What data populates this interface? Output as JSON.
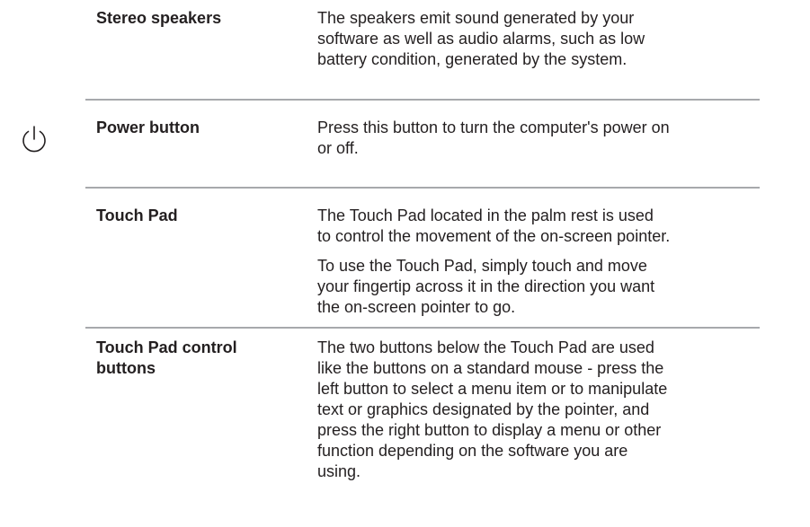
{
  "rows": [
    {
      "term": "Stereo speakers",
      "desc": [
        "The speakers emit sound generated by your",
        "software as well as audio alarms, such as low",
        "battery condition, generated by the system."
      ]
    },
    {
      "term": "Power button",
      "icon": "power-icon",
      "desc": [
        "Press this button to turn the computer's power on",
        "or off."
      ]
    },
    {
      "term": "Touch Pad",
      "desc": [
        "The Touch Pad located in the palm rest is used",
        "to control the movement of the on-screen pointer."
      ],
      "desc2": [
        "To use the Touch Pad, simply touch and move",
        "your fingertip across it in the direction you want",
        "the on-screen pointer to go."
      ]
    },
    {
      "term": [
        "Touch Pad control",
        "buttons"
      ],
      "desc": [
        "The two buttons below the Touch Pad are used",
        "like the buttons on a standard mouse - press the",
        "left button to select a menu item or to manipulate",
        "text or graphics designated by the pointer, and",
        "press the right button to display a menu or other",
        "function depending on the software you are",
        "using."
      ]
    }
  ]
}
